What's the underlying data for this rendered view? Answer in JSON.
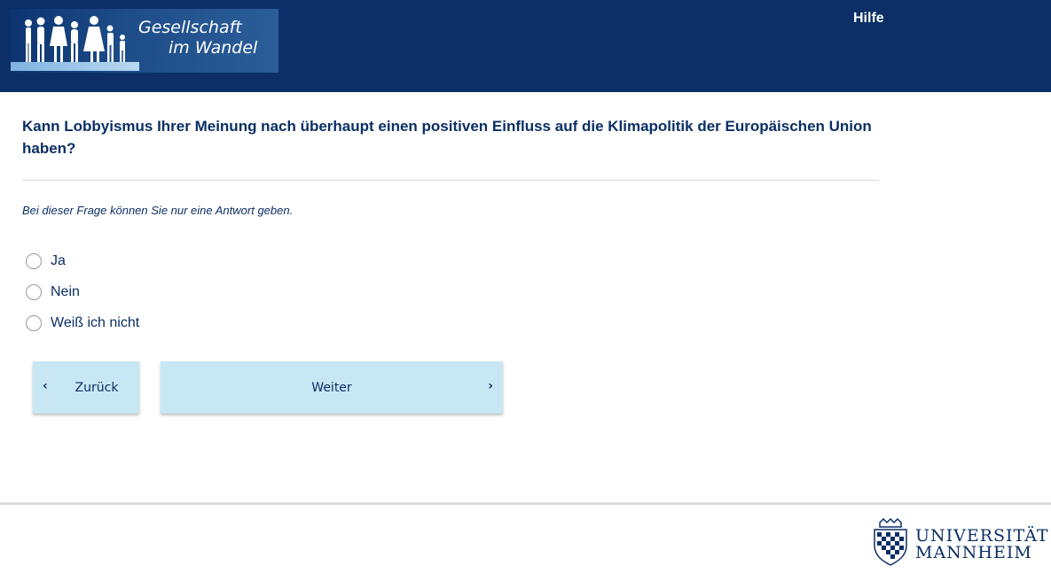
{
  "header": {
    "logo_line1": "Gesellschaft",
    "logo_line2": "im Wandel",
    "help_label": "Hilfe",
    "background_color": "#0b2f66"
  },
  "question": {
    "text": "Kann Lobbyismus Ihrer Meinung nach überhaupt einen positiven Einfluss auf die Klimapolitik der Europäischen Union haben?",
    "instruction": "Bei dieser Frage können Sie nur eine Antwort geben.",
    "options": [
      {
        "label": "Ja",
        "selected": false
      },
      {
        "label": "Nein",
        "selected": false
      },
      {
        "label": "Weiß ich nicht",
        "selected": false
      }
    ]
  },
  "navigation": {
    "back_label": "Zurück",
    "next_label": "Weiter",
    "button_color": "#c8e7f4",
    "back_icon": "chevron-left-icon",
    "next_icon": "chevron-right-icon"
  },
  "footer": {
    "university_line1": "UNIVERSITÄT",
    "university_line2": "MANNHEIM"
  }
}
